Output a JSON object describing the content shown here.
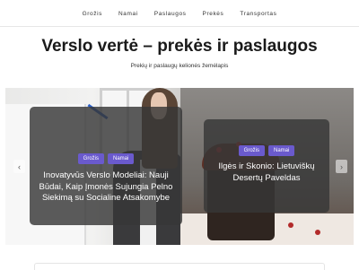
{
  "nav": {
    "items": [
      {
        "label": "Grožis"
      },
      {
        "label": "Namai"
      },
      {
        "label": "Paslaugos"
      },
      {
        "label": "Prekės"
      },
      {
        "label": "Transportas"
      }
    ]
  },
  "header": {
    "title": "Verslo vertė – prekės ir paslaugos",
    "subtitle": "Prekių ir paslaugų kelionės žemėlapis"
  },
  "slider": {
    "prev_icon": "‹",
    "next_icon": "›",
    "slides": [
      {
        "tags": [
          "Grožis",
          "Namai"
        ],
        "title": "Inovatyvūs Verslo Modeliai: Nauji Būdai, Kaip Įmonės Sujungia Pelno Siekimą su Socialine Atsakomybe"
      },
      {
        "tags": [
          "Grožis",
          "Namai"
        ],
        "title": "Ilgės ir Skonio: Lietuviškų Desertų Paveldas"
      }
    ]
  },
  "colors": {
    "tag_bg": "#6a5acd",
    "card_overlay": "rgba(55,55,55,0.82)"
  }
}
